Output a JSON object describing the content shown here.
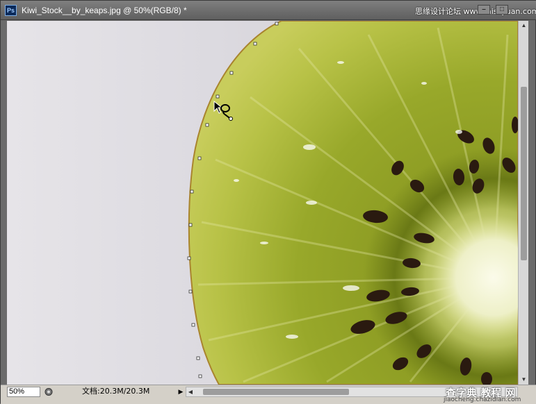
{
  "window": {
    "app_icon_text": "Ps",
    "title": "Kiwi_Stock__by_keaps.jpg @ 50%(RGB/8) *",
    "watermark_top": "思缘设计论坛 www.missyuan.com"
  },
  "canvas": {
    "image_subject": "kiwi-slice",
    "tool": "magnetic-lasso-icon",
    "colors": {
      "background": "#dcdae0",
      "kiwi_flesh": "#9fae2a",
      "kiwi_edge": "#c9cf5a",
      "kiwi_core": "#f1f2d2",
      "seed": "#2a1a10"
    }
  },
  "status": {
    "zoom": "50%",
    "doc_size": "文档:20.3M/20.3M",
    "arrow": "▶"
  },
  "watermark_bottom": {
    "brand": "查字典 教程 网",
    "url": "jiaocheng.chazidian.com"
  }
}
